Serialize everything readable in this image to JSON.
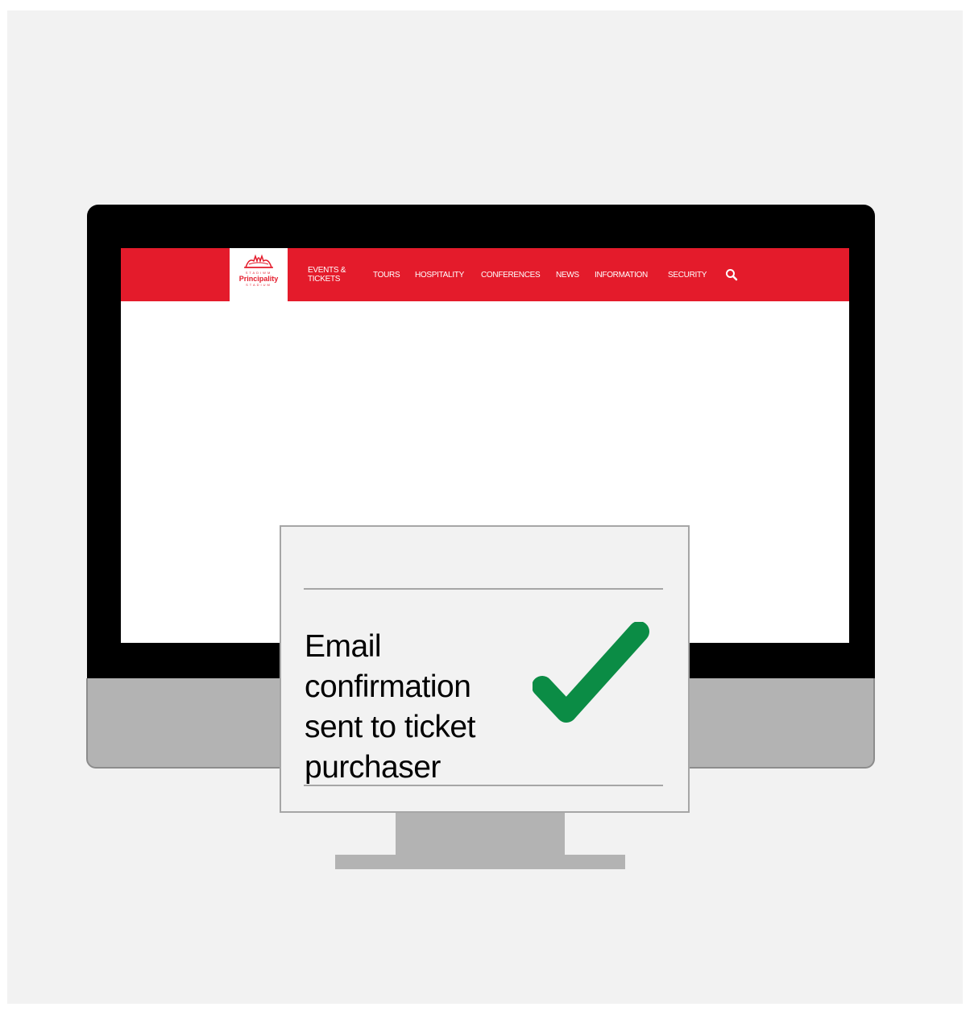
{
  "site": {
    "logo": {
      "line1": "STADIWM",
      "name": "Principality",
      "line3": "STADIUM"
    },
    "nav": {
      "events_tickets": "EVENTS & TICKETS",
      "tours": "TOURS",
      "hospitality": "HOSPITALITY",
      "conferences": "CONFERENCES",
      "news": "NEWS",
      "information": "INFORMATION",
      "security": "SECURITY"
    },
    "brand_color": "#e41b2b"
  },
  "callout": {
    "message": "Email confirmation sent to ticket purchaser",
    "status_icon": "check-icon",
    "check_color": "#0b8c45"
  }
}
